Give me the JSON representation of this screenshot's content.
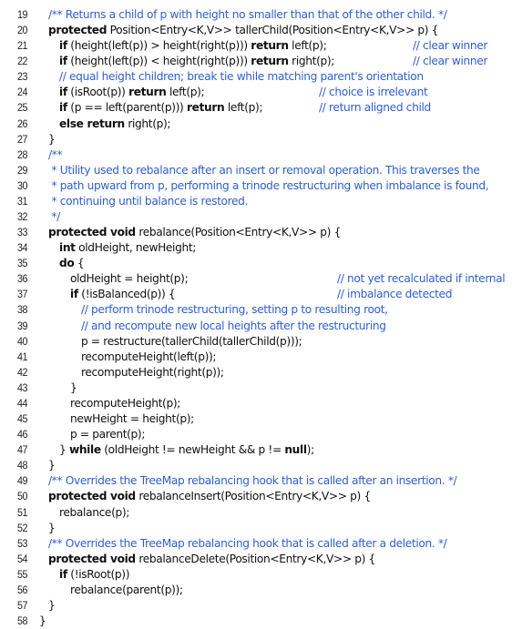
{
  "listing": {
    "comment_color": "#2f5fd0",
    "lines": [
      {
        "n": "19",
        "indent": 0,
        "segs": [
          {
            "t": "/** Returns a child of p with height no smaller than that of the other child. */",
            "c": "cm"
          }
        ]
      },
      {
        "n": "20",
        "indent": 0,
        "segs": [
          {
            "t": "protected",
            "c": "kw"
          },
          {
            "t": " Position<Entry<K,V>> tallerChild(Position<Entry<K,V>> p) {",
            "c": ""
          }
        ]
      },
      {
        "n": "21",
        "indent": 1,
        "segs": [
          {
            "t": "if",
            "c": "kw"
          },
          {
            "t": " (height(left(p)) > height(right(p))) ",
            "c": ""
          },
          {
            "t": "return",
            "c": "kw"
          },
          {
            "t": " left(p);",
            "c": ""
          }
        ],
        "rc": "// clear winner",
        "rcx": 453
      },
      {
        "n": "22",
        "indent": 1,
        "segs": [
          {
            "t": "if",
            "c": "kw"
          },
          {
            "t": " (height(left(p)) < height(right(p))) ",
            "c": ""
          },
          {
            "t": "return",
            "c": "kw"
          },
          {
            "t": " right(p);",
            "c": ""
          }
        ],
        "rc": "// clear winner",
        "rcx": 453
      },
      {
        "n": "23",
        "indent": 1,
        "segs": [
          {
            "t": "// equal height children; break tie while matching parent's orientation",
            "c": "cm"
          }
        ]
      },
      {
        "n": "24",
        "indent": 1,
        "segs": [
          {
            "t": "if",
            "c": "kw"
          },
          {
            "t": " (isRoot(p)) ",
            "c": ""
          },
          {
            "t": "return",
            "c": "kw"
          },
          {
            "t": " left(p);",
            "c": ""
          }
        ],
        "rc": "// choice is irrelevant",
        "rcx": 350
      },
      {
        "n": "25",
        "indent": 1,
        "segs": [
          {
            "t": "if",
            "c": "kw"
          },
          {
            "t": " (p == left(parent(p))) ",
            "c": ""
          },
          {
            "t": "return",
            "c": "kw"
          },
          {
            "t": " left(p);",
            "c": ""
          }
        ],
        "rc": "// return aligned child",
        "rcx": 350
      },
      {
        "n": "26",
        "indent": 1,
        "segs": [
          {
            "t": "else return",
            "c": "kw"
          },
          {
            "t": " right(p);",
            "c": ""
          }
        ]
      },
      {
        "n": "27",
        "indent": 0,
        "segs": [
          {
            "t": "}",
            "c": ""
          }
        ]
      },
      {
        "n": "28",
        "indent": 0,
        "segs": [
          {
            "t": "/**",
            "c": "cm"
          }
        ]
      },
      {
        "n": "29",
        "indent": 0,
        "segs": [
          {
            "t": " * Utility used to rebalance after an insert or removal operation. This traverses the",
            "c": "cm"
          }
        ]
      },
      {
        "n": "30",
        "indent": 0,
        "segs": [
          {
            "t": " * path upward from p, performing a trinode restructuring when imbalance is found,",
            "c": "cm"
          }
        ]
      },
      {
        "n": "31",
        "indent": 0,
        "segs": [
          {
            "t": " * continuing until balance is restored.",
            "c": "cm"
          }
        ]
      },
      {
        "n": "32",
        "indent": 0,
        "segs": [
          {
            "t": " */",
            "c": "cm"
          }
        ]
      },
      {
        "n": "33",
        "indent": 0,
        "segs": [
          {
            "t": "protected void",
            "c": "kw"
          },
          {
            "t": " rebalance(Position<Entry<K,V>> p) {",
            "c": ""
          }
        ]
      },
      {
        "n": "34",
        "indent": 1,
        "segs": [
          {
            "t": "int",
            "c": "kw"
          },
          {
            "t": " oldHeight, newHeight;",
            "c": ""
          }
        ]
      },
      {
        "n": "35",
        "indent": 1,
        "segs": [
          {
            "t": "do",
            "c": "kw"
          },
          {
            "t": " {",
            "c": ""
          }
        ]
      },
      {
        "n": "36",
        "indent": 2,
        "segs": [
          {
            "t": "oldHeight = height(p);",
            "c": ""
          }
        ],
        "rc": "// not yet recalculated if internal",
        "rcx": 370
      },
      {
        "n": "37",
        "indent": 2,
        "segs": [
          {
            "t": "if",
            "c": "kw"
          },
          {
            "t": " (!isBalanced(p)) {",
            "c": ""
          }
        ],
        "rc": "// imbalance detected",
        "rcx": 370
      },
      {
        "n": "38",
        "indent": 3,
        "segs": [
          {
            "t": "// perform trinode restructuring, setting p to resulting root,",
            "c": "cm"
          }
        ]
      },
      {
        "n": "39",
        "indent": 3,
        "segs": [
          {
            "t": "// and recompute new local heights after the restructuring",
            "c": "cm"
          }
        ]
      },
      {
        "n": "40",
        "indent": 3,
        "segs": [
          {
            "t": "p = restructure(tallerChild(tallerChild(p)));",
            "c": ""
          }
        ]
      },
      {
        "n": "41",
        "indent": 3,
        "segs": [
          {
            "t": "recomputeHeight(left(p));",
            "c": ""
          }
        ]
      },
      {
        "n": "42",
        "indent": 3,
        "segs": [
          {
            "t": "recomputeHeight(right(p));",
            "c": ""
          }
        ]
      },
      {
        "n": "43",
        "indent": 2,
        "segs": [
          {
            "t": "}",
            "c": ""
          }
        ]
      },
      {
        "n": "44",
        "indent": 2,
        "segs": [
          {
            "t": "recomputeHeight(p);",
            "c": ""
          }
        ]
      },
      {
        "n": "45",
        "indent": 2,
        "segs": [
          {
            "t": "newHeight = height(p);",
            "c": ""
          }
        ]
      },
      {
        "n": "46",
        "indent": 2,
        "segs": [
          {
            "t": "p = parent(p);",
            "c": ""
          }
        ]
      },
      {
        "n": "47",
        "indent": 1,
        "segs": [
          {
            "t": "} ",
            "c": ""
          },
          {
            "t": "while",
            "c": "kw"
          },
          {
            "t": " (oldHeight != newHeight && p != ",
            "c": ""
          },
          {
            "t": "null",
            "c": "kw"
          },
          {
            "t": ");",
            "c": ""
          }
        ]
      },
      {
        "n": "48",
        "indent": 0,
        "segs": [
          {
            "t": "}",
            "c": ""
          }
        ]
      },
      {
        "n": "49",
        "indent": 0,
        "segs": [
          {
            "t": "/** Overrides the TreeMap rebalancing hook that is called after an insertion. */",
            "c": "cm"
          }
        ]
      },
      {
        "n": "50",
        "indent": 0,
        "segs": [
          {
            "t": "protected void",
            "c": "kw"
          },
          {
            "t": " rebalanceInsert(Position<Entry<K,V>> p) {",
            "c": ""
          }
        ]
      },
      {
        "n": "51",
        "indent": 1,
        "segs": [
          {
            "t": "rebalance(p);",
            "c": ""
          }
        ]
      },
      {
        "n": "52",
        "indent": 0,
        "segs": [
          {
            "t": "}",
            "c": ""
          }
        ]
      },
      {
        "n": "53",
        "indent": 0,
        "segs": [
          {
            "t": "/** Overrides the TreeMap rebalancing hook that is called after a deletion. */",
            "c": "cm"
          }
        ]
      },
      {
        "n": "54",
        "indent": 0,
        "segs": [
          {
            "t": "protected void",
            "c": "kw"
          },
          {
            "t": " rebalanceDelete(Position<Entry<K,V>> p) {",
            "c": ""
          }
        ]
      },
      {
        "n": "55",
        "indent": 1,
        "segs": [
          {
            "t": "if",
            "c": "kw"
          },
          {
            "t": " (!isRoot(p))",
            "c": ""
          }
        ]
      },
      {
        "n": "56",
        "indent": 2,
        "segs": [
          {
            "t": "rebalance(parent(p));",
            "c": ""
          }
        ]
      },
      {
        "n": "57",
        "indent": 0,
        "segs": [
          {
            "t": "}",
            "c": ""
          }
        ]
      },
      {
        "n": "58",
        "indent": -1,
        "segs": [
          {
            "t": "}",
            "c": ""
          }
        ]
      }
    ]
  }
}
